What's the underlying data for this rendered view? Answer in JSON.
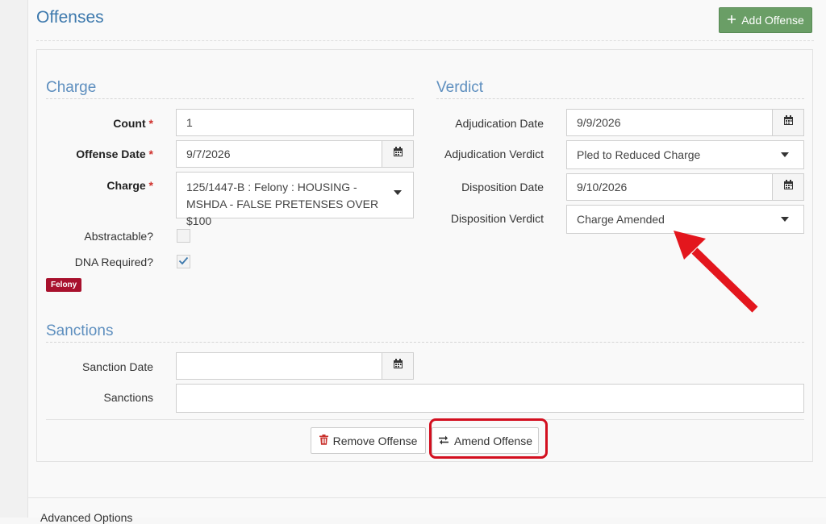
{
  "page": {
    "title": "Offenses"
  },
  "toolbar": {
    "add_offense_label": "Add Offense"
  },
  "charge": {
    "section_title": "Charge",
    "count": {
      "label": "Count",
      "value": "1"
    },
    "offense_date": {
      "label": "Offense Date",
      "value": "9/7/2026"
    },
    "charge": {
      "label": "Charge",
      "value": "125/1447-B : Felony : HOUSING - MSHDA - FALSE PRETENSES OVER $100"
    },
    "abstractable": {
      "label": "Abstractable?",
      "checked": false
    },
    "dna_required": {
      "label": "DNA Required?",
      "checked": true
    },
    "badge": "Felony",
    "required_marker": "*"
  },
  "verdict": {
    "section_title": "Verdict",
    "adjudication_date": {
      "label": "Adjudication Date",
      "value": "9/9/2026"
    },
    "adjudication_verdict": {
      "label": "Adjudication Verdict",
      "value": "Pled to Reduced Charge"
    },
    "disposition_date": {
      "label": "Disposition Date",
      "value": "9/10/2026"
    },
    "disposition_verdict": {
      "label": "Disposition Verdict",
      "value": "Charge Amended"
    }
  },
  "sanctions": {
    "section_title": "Sanctions",
    "sanction_date": {
      "label": "Sanction Date",
      "value": ""
    },
    "sanctions": {
      "label": "Sanctions",
      "value": ""
    }
  },
  "actions": {
    "remove_label": "Remove Offense",
    "amend_label": "Amend Offense"
  },
  "footer": {
    "advanced_options": "Advanced Options"
  },
  "colors": {
    "primary_text": "#3d79ad",
    "add_button": "#6a9e66",
    "badge": "#a8112d",
    "annotation_red": "#d30f1f"
  },
  "icons": {
    "add": "plus-icon",
    "calendar": "calendar-icon",
    "trash": "trash-icon",
    "swap": "swap-arrows-icon",
    "check": "check-icon"
  }
}
